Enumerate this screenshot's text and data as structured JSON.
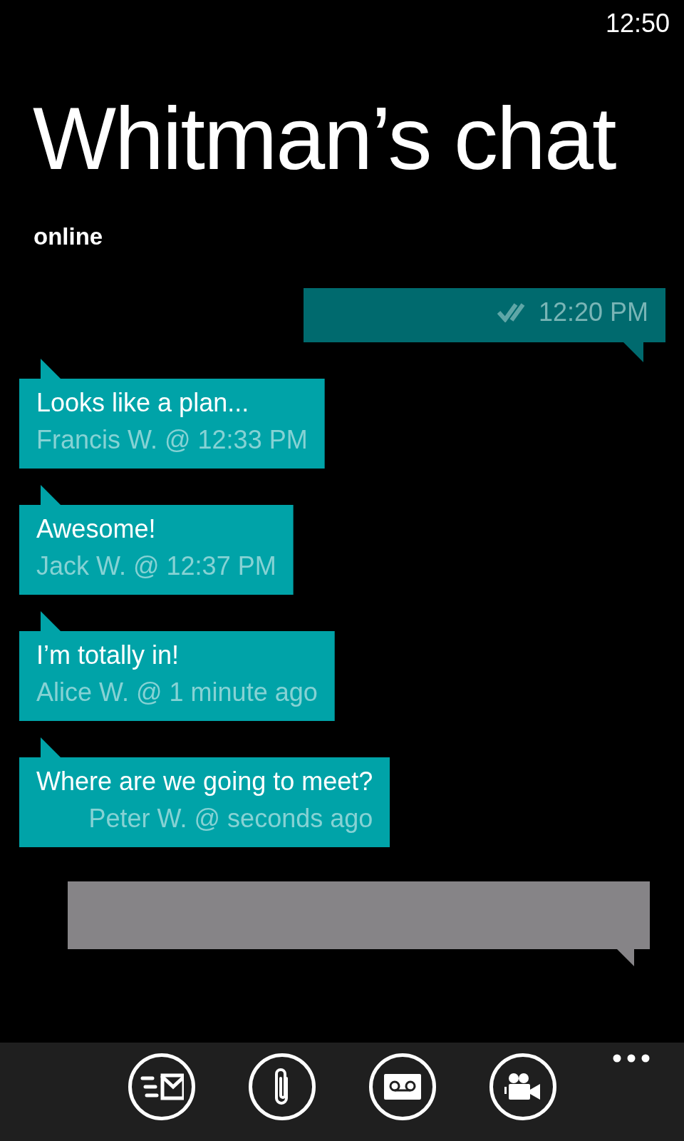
{
  "status_bar": {
    "time": "12:50"
  },
  "title": "Whitman’s chat",
  "subtitle": "online",
  "messages": [
    {
      "kind": "sent",
      "meta": "12:20 PM",
      "delivered": true
    },
    {
      "kind": "received",
      "text": "Looks like a plan...",
      "meta": "Francis W. @ 12:33 PM"
    },
    {
      "kind": "received",
      "text": "Awesome!",
      "meta": "Jack W. @ 12:37 PM"
    },
    {
      "kind": "received",
      "text": "I’m totally in!",
      "meta": "Alice W. @ 1 minute ago"
    },
    {
      "kind": "received",
      "text": "Where are we going to meet?",
      "meta": "Peter W. @ seconds ago"
    }
  ],
  "app_bar": {
    "buttons": [
      {
        "kind": "send"
      },
      {
        "kind": "attach"
      },
      {
        "kind": "voice"
      },
      {
        "kind": "video"
      }
    ]
  }
}
